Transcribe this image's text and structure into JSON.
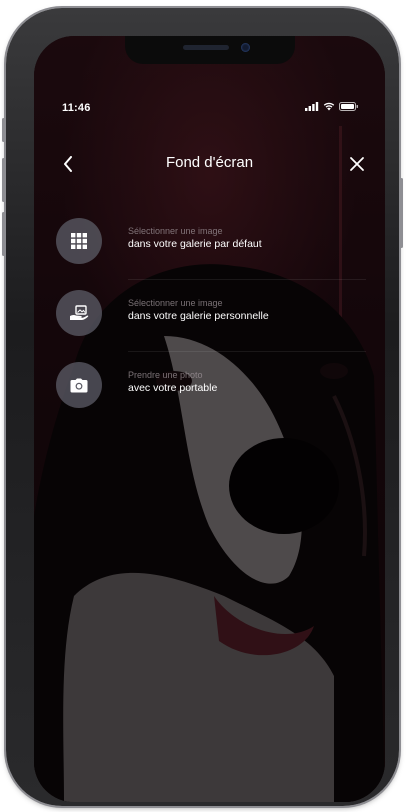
{
  "status_bar": {
    "time": "11:46",
    "icons": [
      "signal-icon",
      "wifi-icon",
      "battery-icon"
    ]
  },
  "header": {
    "title": "Fond d'écran",
    "back_icon": "chevron-left-icon",
    "close_icon": "close-icon"
  },
  "options": [
    {
      "icon": "grid-icon",
      "label": "Sélectionner une image",
      "sub": "dans votre galerie par défaut"
    },
    {
      "icon": "hand-image-icon",
      "label": "Sélectionner une image",
      "sub": "dans votre galerie personnelle"
    },
    {
      "icon": "camera-icon",
      "label": "Prendre une photo",
      "sub": "avec votre portable"
    }
  ],
  "colors": {
    "background_tint": "#1f0a10",
    "icon_circle": "#5a5a64",
    "text_primary": "#ffffff",
    "text_muted": "#a0969b"
  }
}
